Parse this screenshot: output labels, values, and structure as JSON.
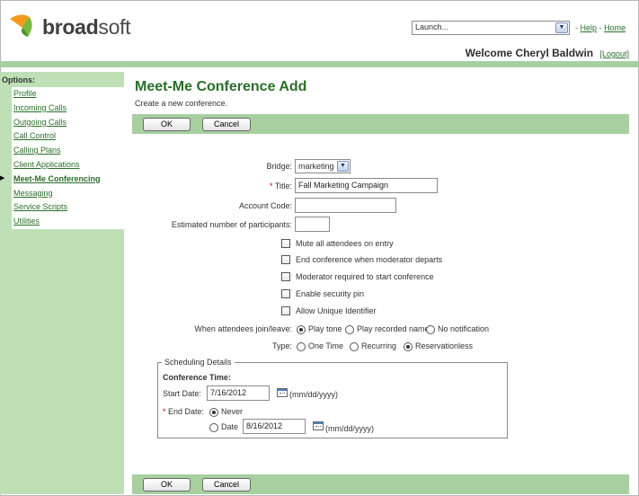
{
  "brand": {
    "prefix": "broad",
    "suffix": "soft"
  },
  "header": {
    "launch_value": "Launch...",
    "links": {
      "sep": "-",
      "help": "Help",
      "home": "Home"
    },
    "welcome": "Welcome Cheryl Baldwin",
    "logout": "[Logout]"
  },
  "sidebar": {
    "title": "Options:",
    "items": [
      {
        "label": "Profile"
      },
      {
        "label": "Incoming Calls"
      },
      {
        "label": "Outgoing Calls"
      },
      {
        "label": "Call Control"
      },
      {
        "label": "Calling Plans"
      },
      {
        "label": "Client Applications"
      },
      {
        "label": "Meet-Me Conferencing",
        "active": true
      },
      {
        "label": "Messaging"
      },
      {
        "label": "Service Scripts"
      },
      {
        "label": "Utilities"
      }
    ]
  },
  "main": {
    "title": "Meet-Me Conference Add",
    "subtitle": "Create a new conference.",
    "ok_label": "OK",
    "cancel_label": "Cancel"
  },
  "form": {
    "bridge_label": "Bridge:",
    "bridge_value": "marketing",
    "title_req": "*",
    "title_label": "Title:",
    "title_value": "Fall Marketing Campaign",
    "account_label": "Account Code:",
    "account_value": "",
    "participants_label": "Estimated number of participants:",
    "participants_value": "",
    "checkboxes": [
      {
        "label": "Mute all attendees on entry",
        "checked": false
      },
      {
        "label": "End conference when moderator departs",
        "checked": false
      },
      {
        "label": "Moderator required to start conference",
        "checked": false
      },
      {
        "label": "Enable security pin",
        "checked": false
      },
      {
        "label": "Allow Unique Identifier",
        "checked": false
      }
    ],
    "join_label": "When attendees join/leave:",
    "join_options": [
      "Play tone",
      "Play recorded name",
      "No notification"
    ],
    "join_selected": "Play tone",
    "type_label": "Type:",
    "type_options": [
      "One Time",
      "Recurring",
      "Reservationless"
    ],
    "type_selected": "Reservationless"
  },
  "scheduling": {
    "legend": "Scheduling Details",
    "conference_time": "Conference Time:",
    "start_label": "Start Date:",
    "start_value": "7/16/2012",
    "date_hint": "(mm/dd/yyyy)",
    "end_req": "*",
    "end_label": "End Date:",
    "never_label": "Never",
    "date_label": "Date",
    "end_value": "8/16/2012",
    "end_selected": "Never"
  },
  "colors": {
    "accent_green": "#2a6e2a",
    "bar_green": "#a7cfa0",
    "sidebar_green": "#bfe0b7",
    "logo_orange": "#f39a1e",
    "logo_green": "#79b93e"
  }
}
